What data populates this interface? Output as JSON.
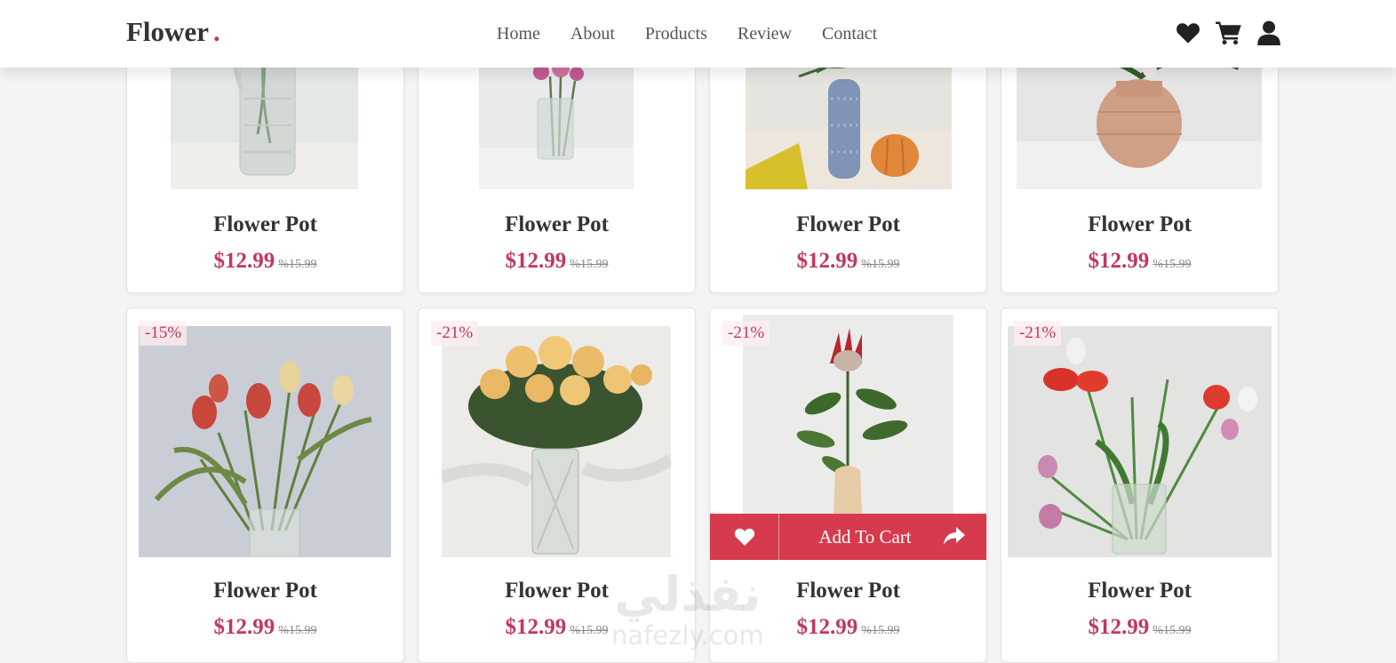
{
  "header": {
    "logo": "Flower",
    "logo_dot": ".",
    "nav": [
      "Home",
      "About",
      "Products",
      "Review",
      "Contact"
    ],
    "icons": [
      "heart-icon",
      "cart-icon",
      "user-icon"
    ]
  },
  "products_row1": [
    {
      "name": "Flower Pot",
      "price": "$12.99",
      "old_price": "%15.99"
    },
    {
      "name": "Flower Pot",
      "price": "$12.99",
      "old_price": "%15.99"
    },
    {
      "name": "Flower Pot",
      "price": "$12.99",
      "old_price": "%15.99"
    },
    {
      "name": "Flower Pot",
      "price": "$12.99",
      "old_price": "%15.99"
    }
  ],
  "products_row2": [
    {
      "badge": "-15%",
      "name": "Flower Pot",
      "price": "$12.99",
      "old_price": "%15.99"
    },
    {
      "badge": "-21%",
      "name": "Flower Pot",
      "price": "$12.99",
      "old_price": "%15.99"
    },
    {
      "badge": "-21%",
      "name": "Flower Pot",
      "price": "$12.99",
      "old_price": "%15.99"
    },
    {
      "badge": "-21%",
      "name": "Flower Pot",
      "price": "$12.99",
      "old_price": "%15.99"
    }
  ],
  "hover_actions": {
    "add_to_cart": "Add To Cart"
  },
  "watermark": {
    "arabic": "نفذلي",
    "latin": "nafezly.com"
  },
  "colors": {
    "accent": "#c2375b",
    "action_bar": "#d63b4d",
    "text": "#333333"
  }
}
